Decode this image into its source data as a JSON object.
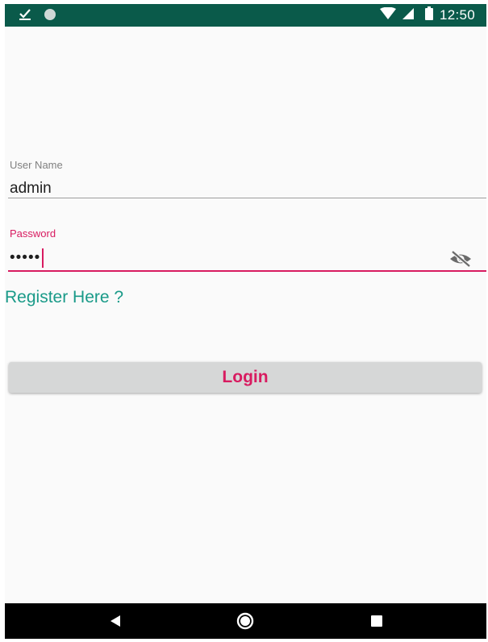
{
  "status_bar": {
    "time": "12:50",
    "icons": [
      "download-done-icon",
      "notification-dot-icon",
      "wifi-icon",
      "signal-icon",
      "battery-icon"
    ]
  },
  "form": {
    "username": {
      "label": "User Name",
      "value": "admin"
    },
    "password": {
      "label": "Password",
      "masked_value": "•••••",
      "toggle_icon": "eye-off-icon"
    }
  },
  "register_link": "Register Here ?",
  "login_button": "Login",
  "nav_bar": {
    "icons": [
      "back-icon",
      "home-icon",
      "recents-icon"
    ]
  },
  "colors": {
    "status_bar": "#0a5a4a",
    "accent": "#d81b60",
    "link": "#199a88",
    "button_bg": "#d6d7d7",
    "background": "#fafafa"
  }
}
